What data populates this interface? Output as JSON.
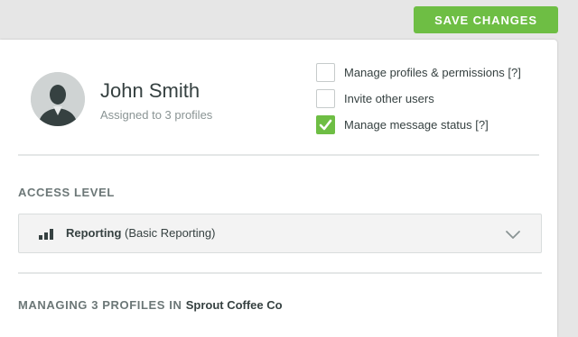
{
  "toolbar": {
    "save_label": "Save Changes"
  },
  "user": {
    "name": "John Smith",
    "subtitle": "Assigned to 3 profiles",
    "avatar_icon": "user-silhouette-icon"
  },
  "permissions": [
    {
      "label": "Manage profiles & permissions [?]",
      "checked": false
    },
    {
      "label": "Invite other users",
      "checked": false
    },
    {
      "label": "Manage message status [?]",
      "checked": true
    }
  ],
  "access": {
    "section_label": "Access Level",
    "selected_strong": "Reporting",
    "selected_detail": " (Basic Reporting)",
    "icon": "bar-chart-icon"
  },
  "managing": {
    "prefix": "Managing 3 profiles in ",
    "org": "Sprout Coffee Co"
  },
  "colors": {
    "accent": "#6ebe44",
    "text": "#364141",
    "muted": "#8a9494"
  }
}
